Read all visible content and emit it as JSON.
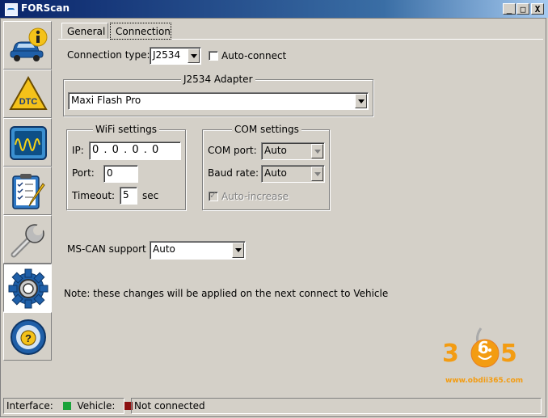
{
  "window": {
    "title": "FORScan",
    "controls": {
      "minimize": "_",
      "maximize": "□",
      "close": "X"
    }
  },
  "nav": {
    "items": [
      {
        "name": "vehicle-info",
        "icon": "car-info-icon"
      },
      {
        "name": "dtc",
        "icon": "dtc-warning-icon",
        "text": "DTC"
      },
      {
        "name": "oscilloscope",
        "icon": "oscilloscope-icon"
      },
      {
        "name": "tests",
        "icon": "checklist-icon"
      },
      {
        "name": "service",
        "icon": "wrench-icon"
      },
      {
        "name": "settings",
        "icon": "gear-icon",
        "active": true
      },
      {
        "name": "help",
        "icon": "help-wheel-icon",
        "text": "?"
      }
    ]
  },
  "tabs": [
    {
      "label": "General",
      "active": false
    },
    {
      "label": "Connection",
      "active": true
    }
  ],
  "connection": {
    "type_label": "Connection type:",
    "type_value": "J2534",
    "auto_connect_label": "Auto-connect",
    "auto_connect_checked": false
  },
  "j2534": {
    "group_title": "J2534 Adapter",
    "adapter_value": "Maxi Flash Pro"
  },
  "wifi": {
    "group_title": "WiFi settings",
    "ip_label": "IP:",
    "ip_value": "0 . 0 . 0 . 0",
    "port_label": "Port:",
    "port_value": "0",
    "timeout_label": "Timeout:",
    "timeout_value": "5",
    "timeout_unit": "sec"
  },
  "com": {
    "group_title": "COM settings",
    "port_label": "COM port:",
    "port_value": "Auto",
    "baud_label": "Baud rate:",
    "baud_value": "Auto",
    "auto_increase_label": "Auto-increase",
    "auto_increase_checked": true
  },
  "mscan": {
    "label": "MS-CAN support",
    "value": "Auto"
  },
  "note": "Note: these changes will be applied on the next connect to Vehicle",
  "status": {
    "interface_label": "Interface:",
    "interface_color": "#1aa33a",
    "vehicle_label": "Vehicle:",
    "vehicle_color": "#8b1010",
    "connection_text": "Not connected"
  },
  "watermark": {
    "digits": [
      "3",
      "6",
      "5"
    ],
    "url": "www.obdii365.com",
    "accent_color": "#f39c12"
  }
}
